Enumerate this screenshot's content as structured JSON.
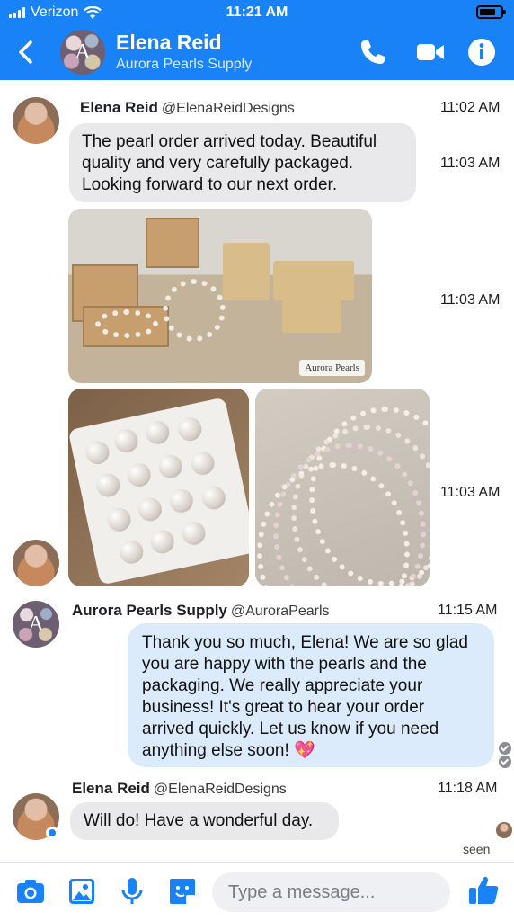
{
  "status": {
    "carrier": "Verizon",
    "time": "11:21 AM"
  },
  "header": {
    "avatar_letter": "A",
    "name": "Elena Reid",
    "subtitle": "Aurora Pearls Supply",
    "icons": [
      "back-chevron-icon",
      "phone-icon",
      "video-icon",
      "info-icon"
    ]
  },
  "colors": {
    "header_bg": "#1a82f7",
    "incoming_bubble": "#e9e9eb",
    "outgoing_bubble": "#dcebfb",
    "accent": "#1a82f7"
  },
  "messages": {
    "m1": {
      "sender": "Elena Reid",
      "handle": "@ElenaReidDesigns",
      "time_header": "11:02 AM",
      "text": "The pearl order arrived today. Beautiful quality and very carefully packaged. Looking forward to our next order.",
      "time": "11:03 AM"
    },
    "m2": {
      "time": "11:03 AM",
      "photo_caption": "Aurora Pearls"
    },
    "m3": {
      "time": "11:03 AM"
    },
    "m4": {
      "sender": "Aurora Pearls Supply",
      "handle": "@AuroraPearls",
      "avatar_letter": "A",
      "time": "11:15 AM",
      "text": "Thank you so much, Elena! We are so glad you are happy with the pearls and the packaging. We really appreciate your business! It's great to hear your order arrived quickly. Let us know if you need anything else soon! 💖"
    },
    "m5": {
      "sender": "Elena Reid",
      "handle": "@ElenaReidDesigns",
      "time": "11:18 AM",
      "text": "Will do! Have a wonderful day.",
      "seen": "seen"
    }
  },
  "composer": {
    "placeholder": "Type a message...",
    "icons": [
      "camera-icon",
      "gallery-icon",
      "microphone-icon",
      "sticker-icon",
      "thumbs-up-icon"
    ]
  }
}
